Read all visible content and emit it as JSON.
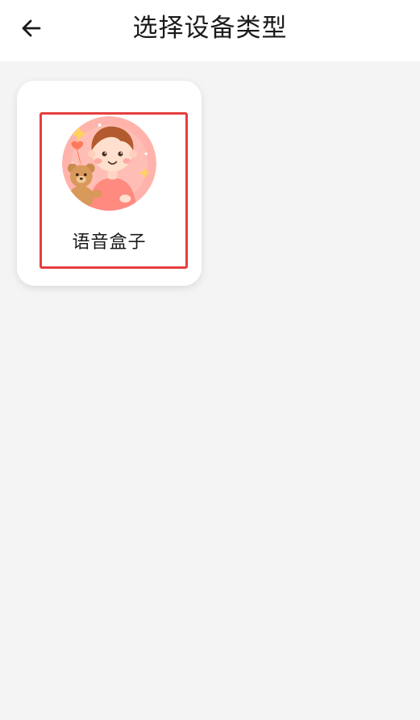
{
  "header": {
    "title": "选择设备类型",
    "back_icon": "arrow-left-icon"
  },
  "devices": [
    {
      "label": "语音盒子",
      "image": "child-with-teddy-bear-avatar",
      "selected": true
    }
  ],
  "colors": {
    "header_bg": "#ffffff",
    "page_bg": "#f4f4f4",
    "highlight": "#e53e3e",
    "avatar_bg": "#ffb3ab"
  }
}
